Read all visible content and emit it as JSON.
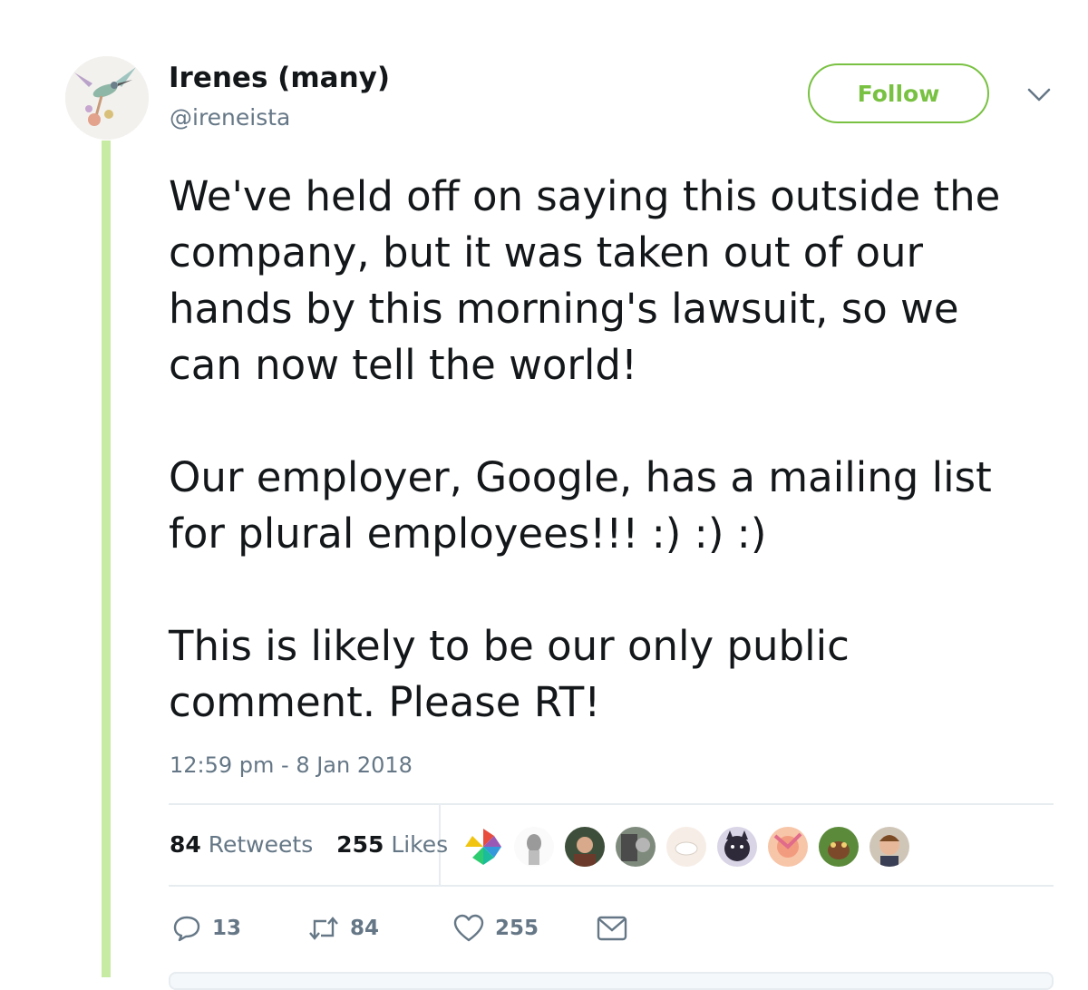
{
  "tweet": {
    "display_name": "Irenes (many)",
    "handle": "@ireneista",
    "follow_label": "Follow",
    "paragraphs": [
      [
        "We've held off on saying this outside the",
        "company, but it was taken out of our",
        "hands by this morning's lawsuit, so we",
        "can now tell the world!"
      ],
      [
        "Our employer, Google, has a mailing list",
        "for plural employees!!! :) :) :)"
      ],
      [
        "This is likely to be our only public",
        "comment. Please RT!"
      ]
    ],
    "timestamp": "12:59 pm - 8 Jan 2018"
  },
  "stats": {
    "retweets_count": "84",
    "retweets_label": "Retweets",
    "likes_count": "255",
    "likes_label": "Likes"
  },
  "actions": {
    "replies": "13",
    "retweets": "84",
    "likes": "255"
  },
  "colors": {
    "accent": "#79c142",
    "thread_line": "#c8eba3",
    "secondary_text": "#657786"
  },
  "icons": {
    "reply": "reply-icon",
    "retweet": "retweet-icon",
    "like": "heart-icon",
    "message": "envelope-icon",
    "more": "chevron-down-icon"
  }
}
